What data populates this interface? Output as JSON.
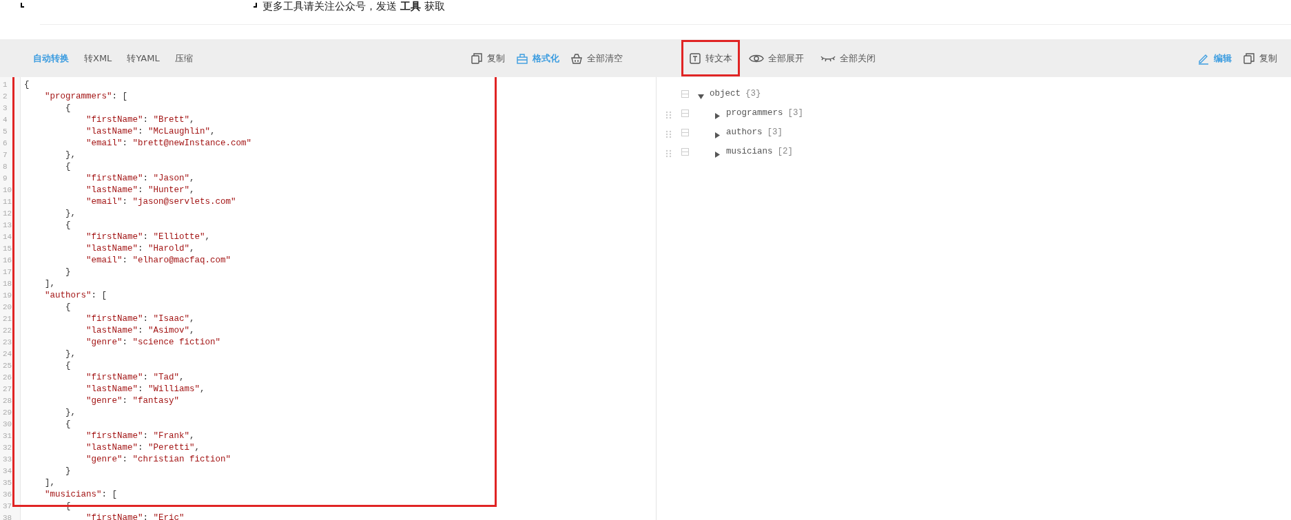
{
  "notice": {
    "text": "更多工具请关注公众号，发送 **工具** 获取"
  },
  "left_toolbar": {
    "tabs": [
      {
        "label": "自动转换",
        "selected": true
      },
      {
        "label": "转XML",
        "selected": false
      },
      {
        "label": "转YAML",
        "selected": false
      },
      {
        "label": "压缩",
        "selected": false
      }
    ],
    "actions": [
      {
        "label": "复制",
        "kind": "copy",
        "active": false
      },
      {
        "label": "格式化",
        "kind": "format",
        "active": true
      },
      {
        "label": "全部清空",
        "kind": "clear",
        "active": false
      }
    ]
  },
  "right_toolbar": {
    "actions": [
      {
        "label": "转文本",
        "kind": "text",
        "active": false,
        "highlighted": true
      },
      {
        "label": "全部展开",
        "kind": "eye",
        "active": false,
        "highlighted": false
      },
      {
        "label": "全部关闭",
        "kind": "eye-closed",
        "active": false,
        "highlighted": false
      }
    ],
    "end_actions": [
      {
        "label": "编辑",
        "kind": "edit",
        "active": true
      },
      {
        "label": "复制",
        "kind": "copy",
        "active": false
      }
    ]
  },
  "editor": {
    "highlighted": true,
    "line_numbers": [
      "1",
      "2",
      "3",
      "4",
      "5",
      "6",
      "7",
      "8",
      "9",
      "10",
      "11",
      "12",
      "13",
      "14",
      "15",
      "16",
      "17",
      "18",
      "19",
      "20",
      "21",
      "22",
      "23",
      "24",
      "25",
      "26",
      "27",
      "28",
      "29",
      "30",
      "31",
      "32",
      "33",
      "34",
      "35",
      "36",
      "37",
      "38"
    ],
    "lines": [
      "{",
      "    \"programmers\": [",
      "        {",
      "            \"firstName\": \"Brett\",",
      "            \"lastName\": \"McLaughlin\",",
      "            \"email\": \"brett@newInstance.com\"",
      "        },",
      "        {",
      "            \"firstName\": \"Jason\",",
      "            \"lastName\": \"Hunter\",",
      "            \"email\": \"jason@servlets.com\"",
      "        },",
      "        {",
      "            \"firstName\": \"Elliotte\",",
      "            \"lastName\": \"Harold\",",
      "            \"email\": \"elharo@macfaq.com\"",
      "        }",
      "    ],",
      "    \"authors\": [",
      "        {",
      "            \"firstName\": \"Isaac\",",
      "            \"lastName\": \"Asimov\",",
      "            \"genre\": \"science fiction\"",
      "        },",
      "        {",
      "            \"firstName\": \"Tad\",",
      "            \"lastName\": \"Williams\",",
      "            \"genre\": \"fantasy\"",
      "        },",
      "        {",
      "            \"firstName\": \"Frank\",",
      "            \"lastName\": \"Peretti\",",
      "            \"genre\": \"christian fiction\"",
      "        }",
      "    ],",
      "    \"musicians\": [",
      "        {",
      "            \"firstName\": \"Eric\""
    ]
  },
  "tree": [
    {
      "label": "object",
      "count": "{3}",
      "expanded": true,
      "checked": false,
      "children": [
        {
          "label": "programmers",
          "count": "[3]",
          "expanded": false,
          "checked": false
        },
        {
          "label": "authors",
          "count": "[3]",
          "expanded": false,
          "checked": false
        },
        {
          "label": "musicians",
          "count": "[2]",
          "expanded": false,
          "checked": false
        }
      ]
    }
  ]
}
